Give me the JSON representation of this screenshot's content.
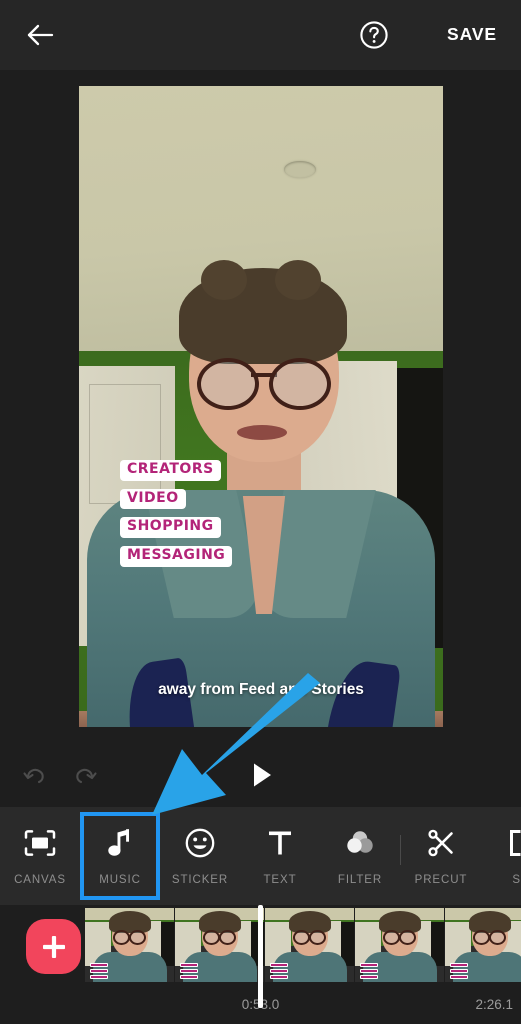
{
  "app": {
    "background_color": "#1e1e1e",
    "surface_color": "#2a2a2a",
    "accent_color": "#2196f3",
    "add_button_color": "#f2455c"
  },
  "topbar": {
    "back_icon": "arrow-left-icon",
    "help_icon": "help-circle-icon",
    "save_label": "SAVE"
  },
  "preview": {
    "keywords": [
      "CREATORS",
      "VIDEO",
      "SHOPPING",
      "MESSAGING"
    ],
    "caption": "away from Feed and Stories",
    "keyword_text_color": "#b32478",
    "keyword_bg_color": "#ffffff"
  },
  "transport": {
    "undo_icon": "undo-arrow-icon",
    "redo_icon": "redo-arrow-icon",
    "play_icon": "play-triangle-icon",
    "undo_enabled": "false",
    "redo_enabled": "false"
  },
  "toolbar": {
    "selected": "MUSIC",
    "items": [
      {
        "label": "CANVAS",
        "icon": "canvas-crop-icon",
        "selected": "false"
      },
      {
        "label": "MUSIC",
        "icon": "music-note-icon",
        "selected": "true"
      },
      {
        "label": "STICKER",
        "icon": "smiley-face-icon",
        "selected": "false"
      },
      {
        "label": "TEXT",
        "icon": "text-t-icon",
        "selected": "false"
      },
      {
        "label": "FILTER",
        "icon": "filter-circles-icon",
        "selected": "false"
      },
      {
        "label": "PRECUT",
        "icon": "scissors-icon",
        "selected": "false"
      },
      {
        "label": "SP",
        "icon": "speed-bracket-icon",
        "selected": "false"
      }
    ]
  },
  "timeline": {
    "add_clip_icon": "plus-icon",
    "current_time": "0:53.0",
    "total_time": "2:26.1",
    "frame_count": 5
  },
  "annotation": {
    "arrow_color": "#29a3e8",
    "points_to": "MUSIC"
  }
}
